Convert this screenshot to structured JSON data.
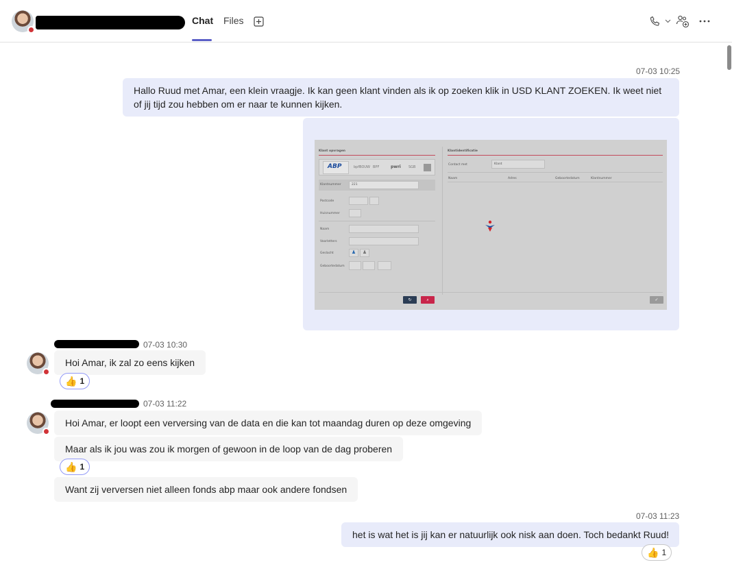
{
  "header": {
    "tabs": [
      {
        "label": "Chat"
      },
      {
        "label": "Files"
      }
    ]
  },
  "messages": {
    "m1": {
      "time": "07-03 10:25",
      "text": "Hallo Ruud met Amar, een klein vraagje. Ik kan geen klant vinden als ik op zoeken klik in USD KLANT ZOEKEN. Ik weet niet of jij tijd zou hebben om er naar te kunnen kijken."
    },
    "m2": {
      "time": "07-03 10:30",
      "text": "Hoi Amar, ik zal zo eens kijken",
      "reaction": {
        "emoji": "👍",
        "count": "1"
      }
    },
    "m3": {
      "time": "07-03 11:22",
      "text1": "Hoi Amar, er loopt een verversing van de data en die kan tot maandag duren op deze omgeving",
      "text2": "Maar als ik jou was zou ik morgen of gewoon in de loop van de dag proberen",
      "reaction": {
        "emoji": "👍",
        "count": "1"
      },
      "text3": "Want zij verversen niet alleen fonds abp maar ook andere fondsen"
    },
    "m4": {
      "time": "07-03 11:23",
      "text": "het is wat het is jij kan er natuurlijk ook nisk aan doen. Toch bedankt Ruud!",
      "reaction": {
        "emoji": "👍",
        "count": "1"
      }
    }
  },
  "screenshot": {
    "left_title": "Klant opvragen",
    "right_title": "Klantidentificatie",
    "logos": [
      "ABP",
      "BPF",
      "bpfBOUW",
      "pwri",
      "SGB"
    ],
    "fields": [
      "Klantnummer",
      "Postcode",
      "Huisnummer",
      "Naam",
      "Voorletters",
      "Geslacht",
      "Geboortedatum"
    ],
    "klantnummer_value": "221",
    "contact_label": "Contact met",
    "contact_value": "Klant",
    "columns": [
      "Naam",
      "Adres",
      "Geboortedatum",
      "Klantnummer"
    ]
  },
  "colors": {
    "accent": "#5b5fc7",
    "my_bubble": "#e8ebfa",
    "their_bubble": "#f5f5f5",
    "status_busy": "#d13438"
  }
}
